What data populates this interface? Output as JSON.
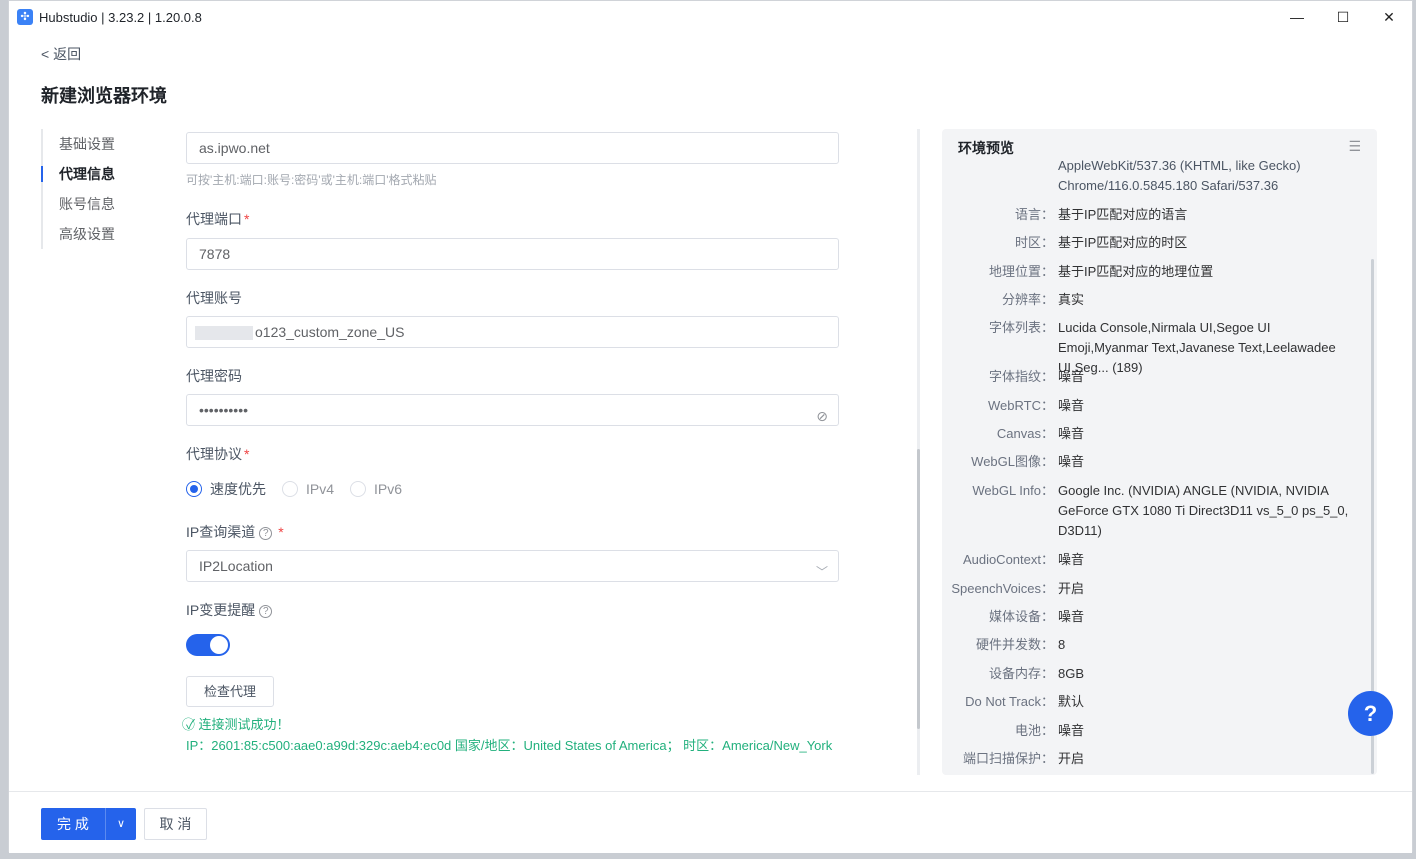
{
  "app": {
    "title": "Hubstudio | 3.23.2 | 1.20.0.8"
  },
  "window_controls": {
    "minimize": "—",
    "maximize": "☐",
    "close": "✕"
  },
  "nav": {
    "back": "< 返回"
  },
  "page": {
    "title": "新建浏览器环境"
  },
  "sidebar": {
    "items": [
      {
        "label": "基础设置"
      },
      {
        "label": "代理信息"
      },
      {
        "label": "账号信息"
      },
      {
        "label": "高级设置"
      }
    ]
  },
  "form": {
    "host_value": "as.ipwo.net",
    "host_hint": "可按'主机:端口:账号:密码'或'主机:端口'格式粘贴",
    "port_label": "代理端口",
    "port_value": "7878",
    "account_label": "代理账号",
    "account_value": "o123_custom_zone_US",
    "password_label": "代理密码",
    "password_value": "••••••••••",
    "protocol_label": "代理协议",
    "protocol_options": [
      "速度优先",
      "IPv4",
      "IPv6"
    ],
    "ip_channel_label": "IP查询渠道",
    "ip_channel_value": "IP2Location",
    "ip_change_label": "IP变更提醒",
    "check_button": "检查代理",
    "success_text": "连接测试成功！",
    "ip_result": "IP：2601:85:c500:aae0:a99d:329c:aeb4:ec0d 国家/地区：United States of America； 时区：America/New_York",
    "required_mark": "*",
    "help_mark": "?"
  },
  "preview": {
    "title": "环境预览",
    "ua_lines": [
      "AppleWebKit/537.36 (KHTML, like Gecko)",
      "Chrome/116.0.5845.180 Safari/537.36"
    ],
    "rows": [
      {
        "k": "语言：",
        "v": "基于IP匹配对应的语言"
      },
      {
        "k": "时区：",
        "v": "基于IP匹配对应的时区"
      },
      {
        "k": "地理位置：",
        "v": "基于IP匹配对应的地理位置"
      },
      {
        "k": "分辨率：",
        "v": "真实"
      },
      {
        "k": "字体列表：",
        "v": "Lucida Console,Nirmala UI,Segoe UI Emoji,Myanmar Text,Javanese Text,Leelawadee UI,Seg... (189)"
      },
      {
        "k": "字体指纹：",
        "v": "噪音"
      },
      {
        "k": "WebRTC：",
        "v": "噪音"
      },
      {
        "k": "Canvas：",
        "v": "噪音"
      },
      {
        "k": "WebGL图像：",
        "v": "噪音"
      },
      {
        "k": "WebGL Info：",
        "v": "Google Inc. (NVIDIA) ANGLE (NVIDIA, NVIDIA GeForce GTX 1080 Ti Direct3D11 vs_5_0 ps_5_0, D3D11)"
      },
      {
        "k": "AudioContext：",
        "v": "噪音"
      },
      {
        "k": "SpeenchVoices：",
        "v": "开启"
      },
      {
        "k": "媒体设备：",
        "v": "噪音"
      },
      {
        "k": "硬件并发数：",
        "v": "8"
      },
      {
        "k": "设备内存：",
        "v": "8GB"
      },
      {
        "k": "Do Not Track：",
        "v": "默认"
      },
      {
        "k": "电池：",
        "v": "噪音"
      },
      {
        "k": "端口扫描保护：",
        "v": "开启"
      }
    ]
  },
  "help_fab": "?",
  "footer": {
    "done": "完 成",
    "cancel": "取 消"
  },
  "colors": {
    "primary": "#2563eb",
    "success": "#22b07d",
    "required": "#ef4444"
  }
}
